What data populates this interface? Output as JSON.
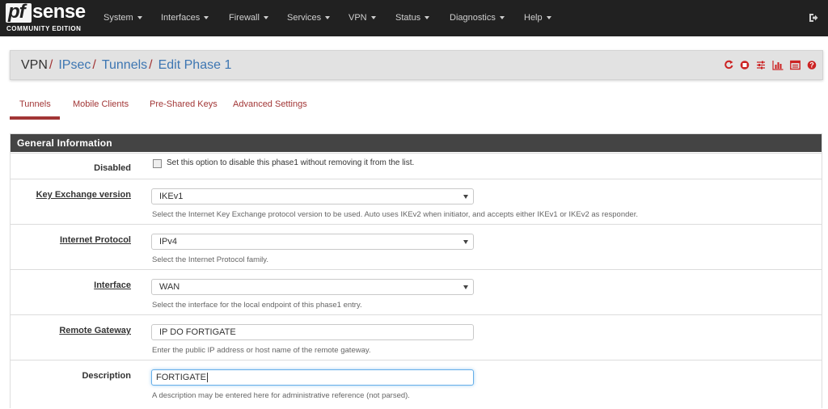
{
  "brand": {
    "logo_text": "pfsense",
    "edition": "COMMUNITY EDITION"
  },
  "nav": {
    "items": [
      {
        "label": "System"
      },
      {
        "label": "Interfaces"
      },
      {
        "label": "Firewall"
      },
      {
        "label": "Services"
      },
      {
        "label": "VPN"
      },
      {
        "label": "Status"
      },
      {
        "label": "Diagnostics"
      },
      {
        "label": "Help"
      }
    ],
    "logout_icon": "sign-out-icon"
  },
  "breadcrumb": {
    "items": [
      {
        "label": "VPN",
        "sep": "/"
      },
      {
        "label": "IPsec",
        "sep": "/"
      },
      {
        "label": "Tunnels",
        "sep": "/"
      },
      {
        "label": "Edit Phase 1"
      }
    ],
    "icons": [
      "restart-service-icon",
      "stop-service-icon",
      "sliders-icon",
      "bar-chart-icon",
      "log-list-icon",
      "help-icon"
    ]
  },
  "tabs": [
    {
      "label": "Tunnels",
      "active": true
    },
    {
      "label": "Mobile Clients",
      "active": false
    },
    {
      "label": "Pre-Shared Keys",
      "active": false
    },
    {
      "label": "Advanced Settings",
      "active": false
    }
  ],
  "panel": {
    "heading": "General Information",
    "fields": {
      "disabled": {
        "label": "Disabled",
        "checked": false,
        "text": "Set this option to disable this phase1 without removing it from the list."
      },
      "key_exchange": {
        "label": "Key Exchange version",
        "value": "IKEv1",
        "help": "Select the Internet Key Exchange protocol version to be used. Auto uses IKEv2 when initiator, and accepts either IKEv1 or IKEv2 as responder."
      },
      "protocol": {
        "label": "Internet Protocol",
        "value": "IPv4",
        "help": "Select the Internet Protocol family."
      },
      "interface": {
        "label": "Interface",
        "value": "WAN",
        "help": "Select the interface for the local endpoint of this phase1 entry."
      },
      "remote_gateway": {
        "label": "Remote Gateway",
        "value": "IP DO FORTIGATE",
        "help": "Enter the public IP address or host name of the remote gateway."
      },
      "description": {
        "label": "Description",
        "value": "FORTIGATE",
        "help": "A description may be entered here for administrative reference (not parsed)."
      }
    }
  },
  "colors": {
    "navbar": "#212121",
    "accent": "#a23636",
    "link": "#3d76b2",
    "panel_heading": "#444444"
  }
}
